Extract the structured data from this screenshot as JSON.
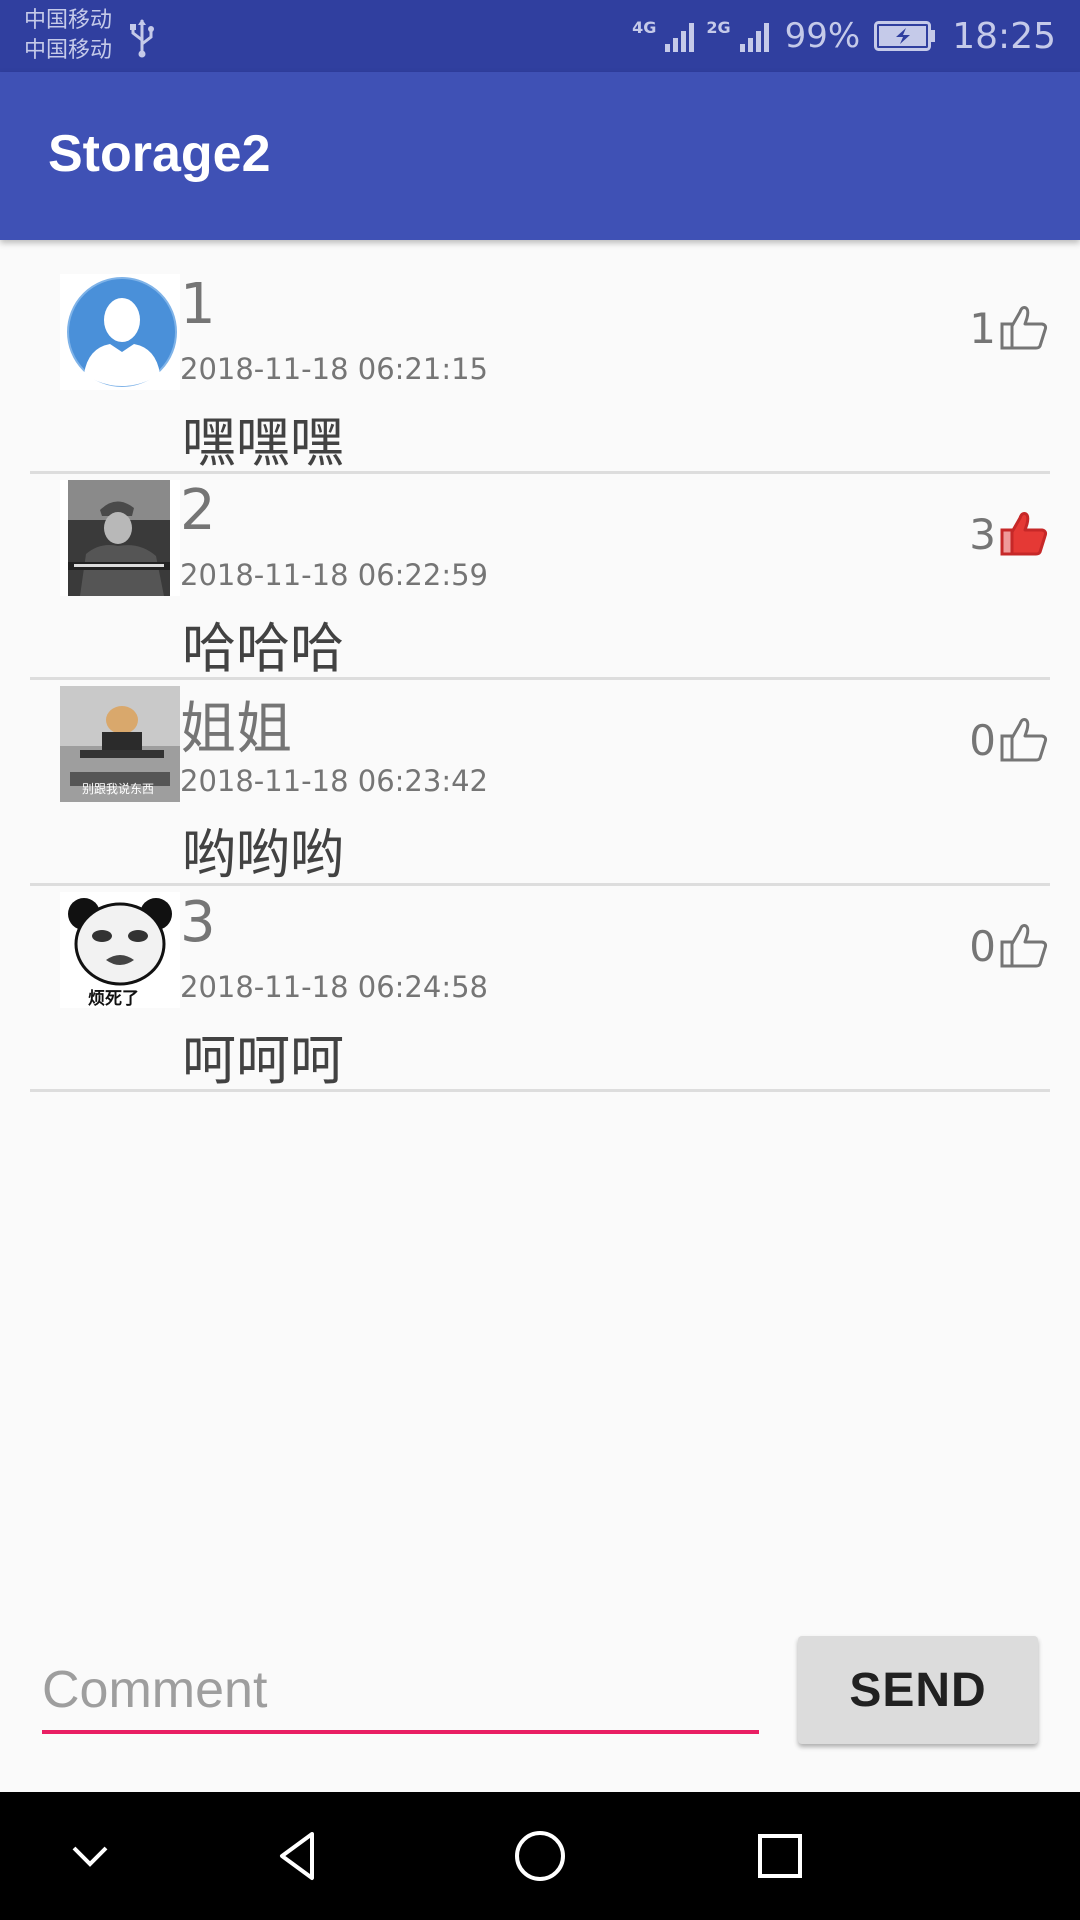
{
  "status_bar": {
    "carrier_1": "中国移动",
    "carrier_2": "中国移动",
    "network_1": "4G",
    "network_2": "2G",
    "battery": "99%",
    "time": "18:25",
    "icons": [
      "usb-icon",
      "signal-icon",
      "battery-charging-icon"
    ]
  },
  "toolbar": {
    "title": "Storage2"
  },
  "comments": [
    {
      "name": "1",
      "time": "2018-11-18 06:21:15",
      "text": "嘿嘿嘿",
      "likes": "1",
      "liked": false,
      "avatar": "default-person-avatar"
    },
    {
      "name": "2",
      "time": "2018-11-18 06:22:59",
      "text": "哈哈哈",
      "likes": "3",
      "liked": true,
      "avatar": "soldier-photo-avatar"
    },
    {
      "name": "姐姐",
      "time": "2018-11-18 06:23:42",
      "text": "哟哟哟",
      "likes": "0",
      "liked": false,
      "avatar": "cat-photo-avatar"
    },
    {
      "name": "3",
      "time": "2018-11-18 06:24:58",
      "text": "呵呵呵",
      "likes": "0",
      "liked": false,
      "avatar": "panda-meme-avatar"
    }
  ],
  "avatar_captions": {
    "cat": "别跟我说东西",
    "panda": "烦死了"
  },
  "composer": {
    "placeholder": "Comment",
    "send_label": "SEND"
  },
  "colors": {
    "status_bar": "#303f9f",
    "toolbar": "#3f51b5",
    "accent": "#e91e63",
    "like_active": "#e53935"
  }
}
